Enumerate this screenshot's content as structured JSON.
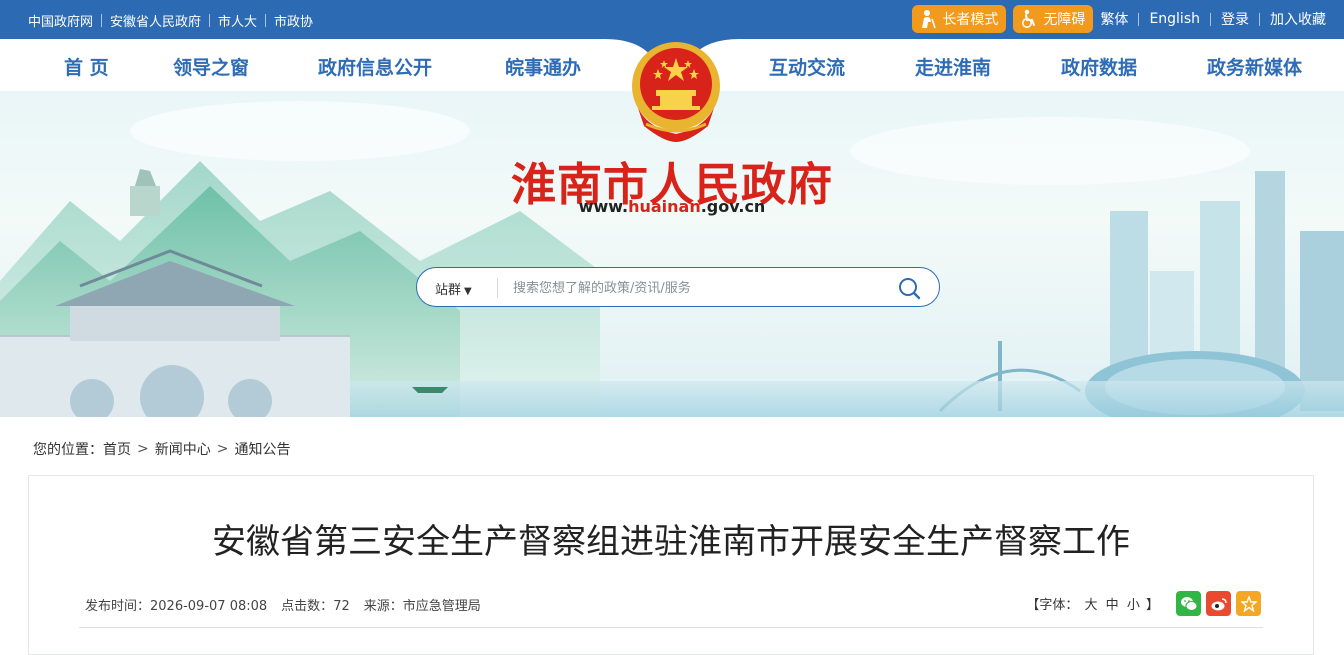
{
  "topbar": {
    "links": [
      "中国政府网",
      "安徽省人民政府",
      "市人大",
      "市政协"
    ],
    "elder_mode": "长者模式",
    "accessible": "无障碍",
    "traditional": "繁体",
    "english": "English",
    "login": "登录",
    "bookmark": "加入收藏"
  },
  "nav": {
    "items": [
      "首 页",
      "领导之窗",
      "政府信息公开",
      "皖事通办",
      "互动交流",
      "走进淮南",
      "政府数据",
      "政务新媒体"
    ]
  },
  "banner": {
    "title": "淮南市人民政府",
    "url_prefix": "www.",
    "url_highlight": "huainan",
    "url_suffix": ".gov.cn"
  },
  "search": {
    "scope": "站群",
    "placeholder": "搜索您想了解的政策/资讯/服务"
  },
  "breadcrumb": {
    "prefix": "您的位置：",
    "items": [
      "首页",
      "新闻中心",
      "通知公告"
    ]
  },
  "article": {
    "title": "安徽省第三安全生产督察组进驻淮南市开展安全生产督察工作",
    "publish_label": "发布时间：",
    "publish_time": "2026-09-07 08:08",
    "clicks_label": "点击数：",
    "clicks": "72",
    "source_label": "来源：",
    "source": "市应急管理局",
    "font_label": "【字体：",
    "font_options": [
      "大",
      "中",
      "小"
    ],
    "font_end": "】"
  },
  "colors": {
    "topbar": "#2d6ab4",
    "nav_text": "#2f6cb6",
    "title_red": "#d7231a",
    "pill_orange": "#f29a1e"
  },
  "icons": [
    "elder-icon",
    "wheelchair-icon",
    "national-emblem",
    "search-icon",
    "wechat-icon",
    "weibo-icon",
    "favorite-icon"
  ]
}
